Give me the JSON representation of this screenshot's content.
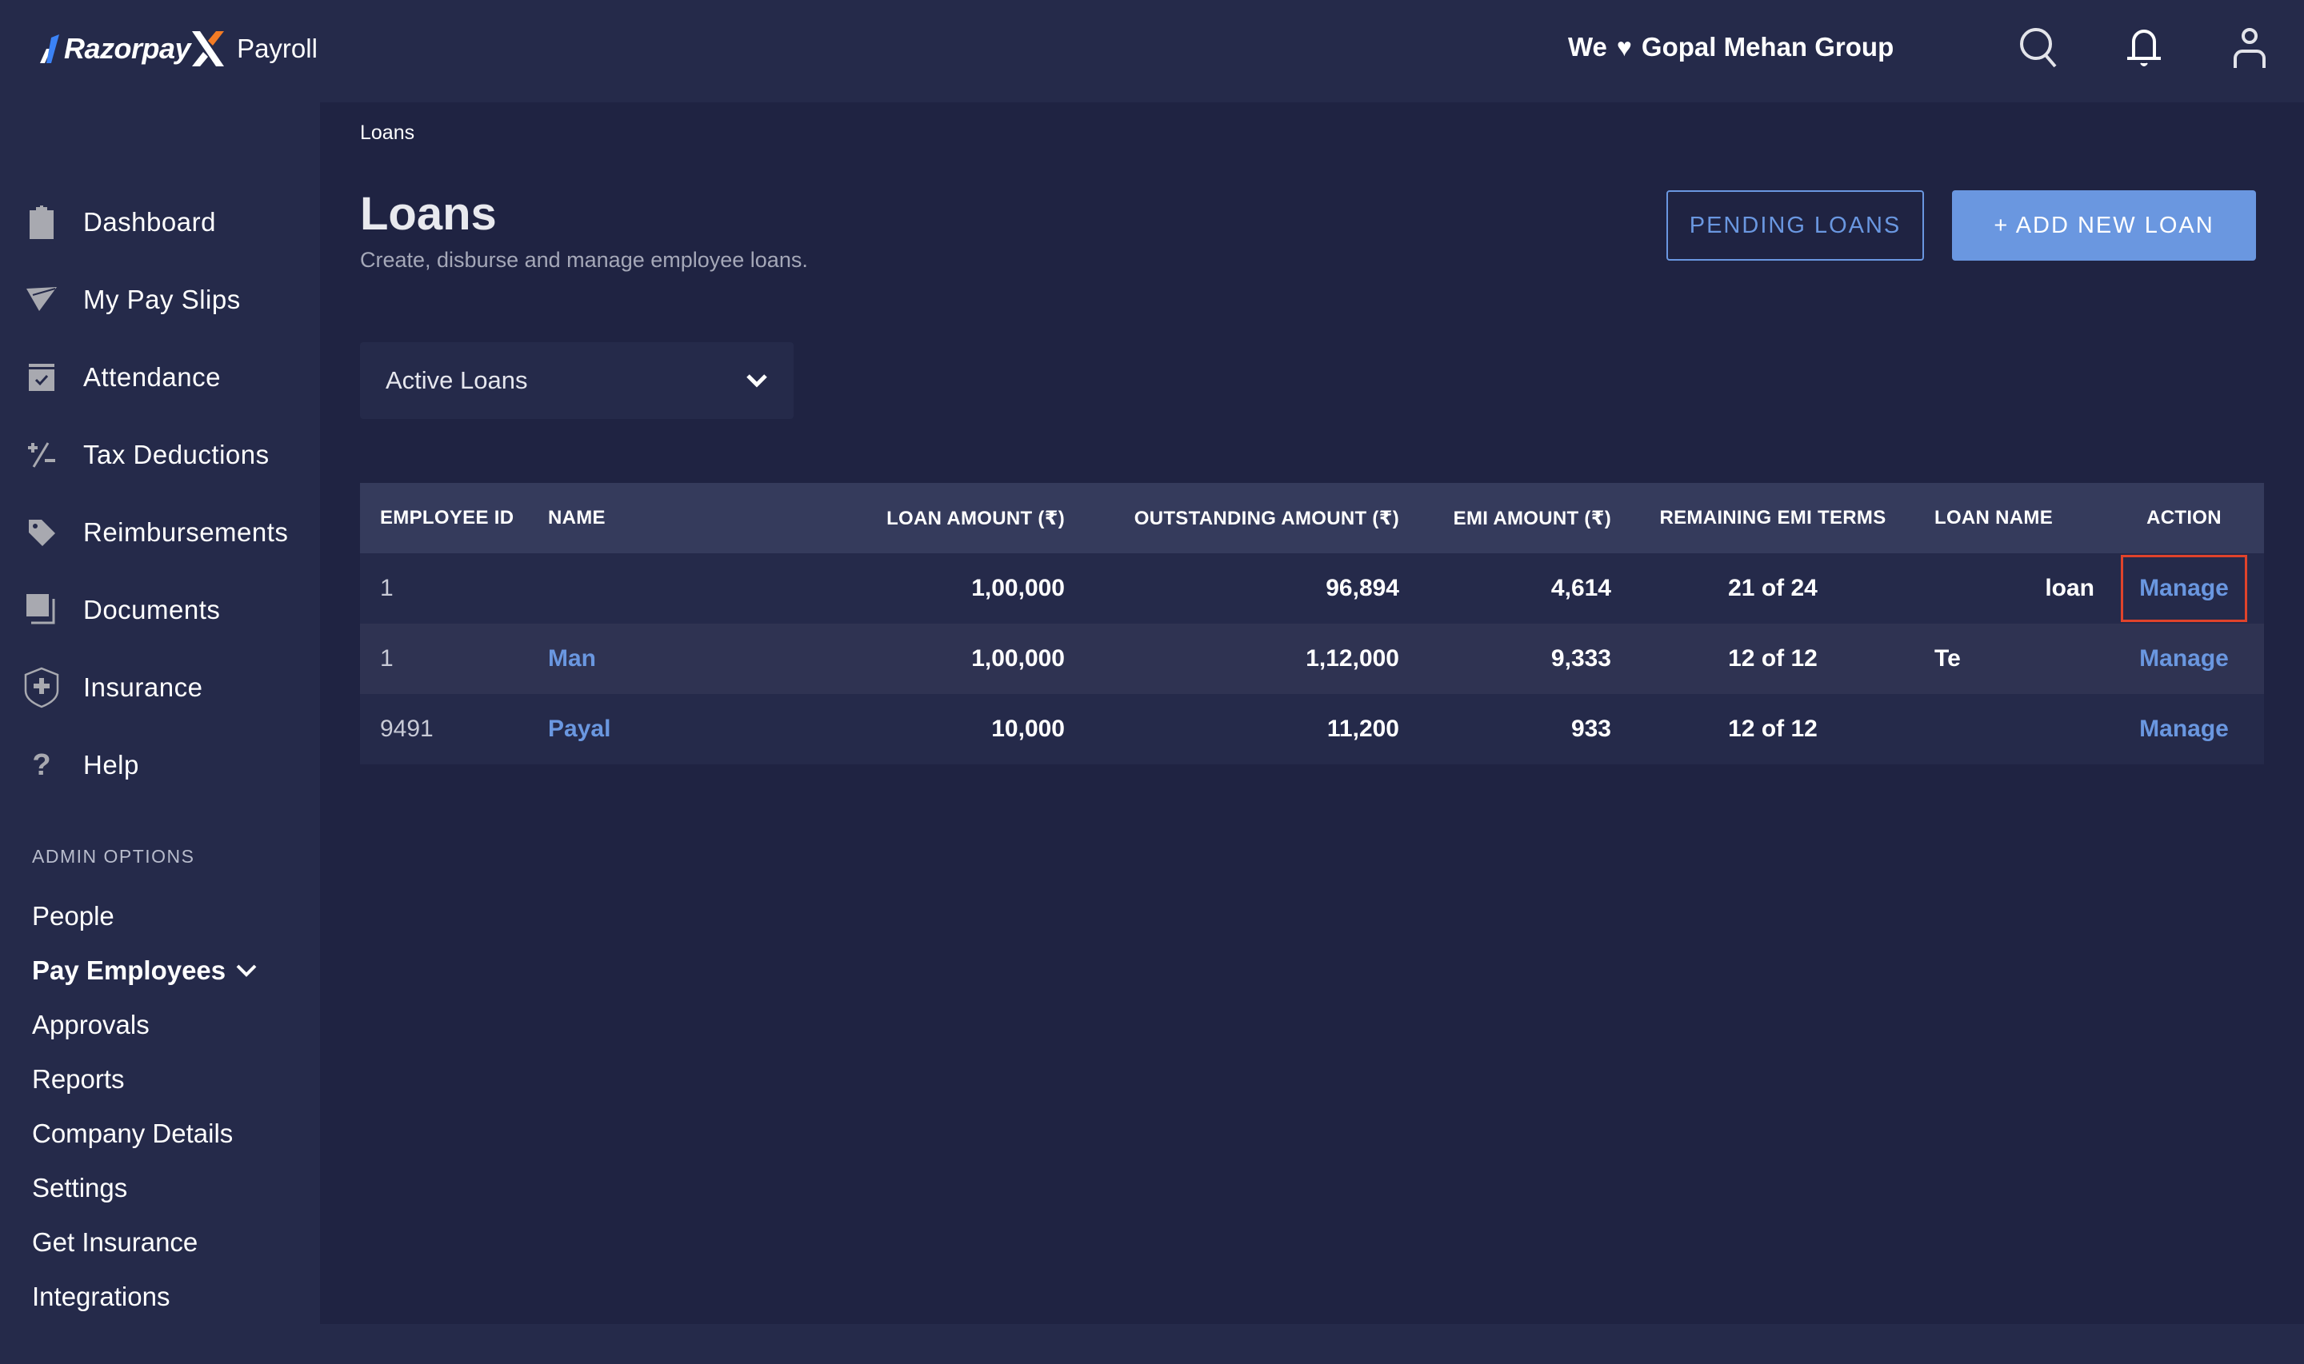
{
  "app": {
    "brand": "Razorpay",
    "product": "Payroll",
    "company_greeting_prefix": "We",
    "company_name": "Gopal Mehan Group",
    "accent_color": "#6a97e0",
    "highlight_color": "#e0432b"
  },
  "topbar": {
    "icons": [
      "search-icon",
      "bell-icon",
      "user-icon"
    ]
  },
  "sidebar": {
    "items": [
      {
        "label": "Dashboard",
        "icon": "clipboard-icon"
      },
      {
        "label": "My Pay Slips",
        "icon": "paper-plane-icon"
      },
      {
        "label": "Attendance",
        "icon": "calendar-check-icon"
      },
      {
        "label": "Tax Deductions",
        "icon": "plus-minus-icon"
      },
      {
        "label": "Reimbursements",
        "icon": "tag-icon"
      },
      {
        "label": "Documents",
        "icon": "documents-icon"
      },
      {
        "label": "Insurance",
        "icon": "shield-plus-icon"
      },
      {
        "label": "Help",
        "icon": "question-icon"
      }
    ],
    "admin_heading": "ADMIN OPTIONS",
    "admin_items": [
      {
        "label": "People"
      },
      {
        "label": "Pay Employees",
        "expanded": true
      },
      {
        "label": "Approvals"
      },
      {
        "label": "Reports"
      },
      {
        "label": "Company Details"
      },
      {
        "label": "Settings"
      },
      {
        "label": "Get Insurance"
      },
      {
        "label": "Integrations"
      }
    ]
  },
  "main": {
    "breadcrumb": "Loans",
    "title": "Loans",
    "subtitle": "Create, disburse and manage employee loans.",
    "pending_button": "PENDING LOANS",
    "add_button": "+ ADD NEW LOAN",
    "filter": {
      "selected": "Active Loans"
    },
    "table": {
      "headers": [
        "EMPLOYEE ID",
        "NAME",
        "LOAN AMOUNT (₹)",
        "OUTSTANDING AMOUNT (₹)",
        "EMI AMOUNT (₹)",
        "REMAINING EMI TERMS",
        "LOAN NAME",
        "ACTION"
      ],
      "rows": [
        {
          "employee_id": "1",
          "name": "",
          "loan_amount": "1,00,000",
          "outstanding": "96,894",
          "emi": "4,614",
          "remaining": "21 of 24",
          "loan_name": "loan",
          "action": "Manage"
        },
        {
          "employee_id": "1",
          "name": "Man",
          "loan_amount": "1,00,000",
          "outstanding": "1,12,000",
          "emi": "9,333",
          "remaining": "12 of 12",
          "loan_name": "Te",
          "action": "Manage"
        },
        {
          "employee_id": "9491",
          "name": "Payal",
          "loan_amount": "10,000",
          "outstanding": "11,200",
          "emi": "933",
          "remaining": "12 of 12",
          "loan_name": "",
          "action": "Manage"
        }
      ]
    }
  }
}
